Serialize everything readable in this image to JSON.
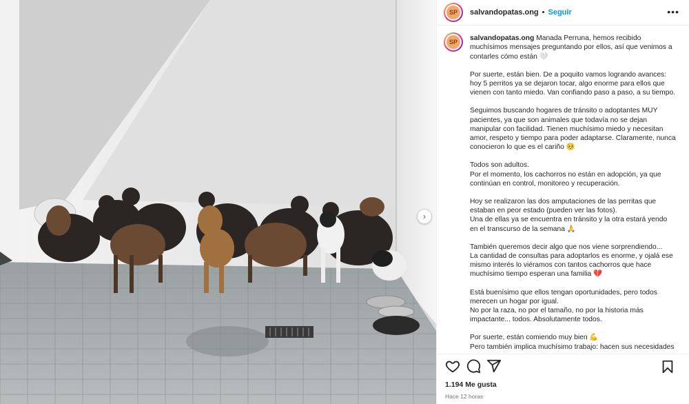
{
  "account": {
    "username": "salvandopatas.ong",
    "separator": "•",
    "follow_label": "Seguir",
    "more_icon": "more-horizontal-icon",
    "avatar_text": "SP"
  },
  "caption": {
    "username": "salvandopatas.ong",
    "paragraphs": [
      "Manada Perruna, hemos recibido muchísimos mensajes preguntando por ellos, así que venimos a contarles cómo están 🤍",
      "Por suerte, están bien. De a poquito vamos logrando avances: hoy 5 perritos ya se dejaron tocar, algo enorme para ellos que vienen con tanto miedo. Van confiando paso a paso, a su tiempo.",
      "Seguimos buscando hogares de tránsito o adoptantes MUY pacientes, ya que son animales que todavía no se dejan manipular con facilidad. Tienen muchísimo miedo y necesitan amor, respeto y tiempo para poder adaptarse. Claramente, nunca conocieron lo que es el cariño 🥺",
      "Todos son adultos.\nPor el momento, los cachorros no están en adopción, ya que continúan en control, monitoreo y recuperación.",
      "Hoy se realizaron las dos amputaciones de las perritas que estaban en peor estado (pueden ver las fotos).\nUna de ellas ya se encuentra en tránsito y la otra estará yendo en el transcurso de la semana 🙏",
      "También queremos decir algo que nos viene sorprendiendo...\nLa cantidad de consultas para adoptarlos es enorme, y ojalá ese mismo interés lo viéramos con tantos cachorros que hace muchísimo tiempo esperan una familia 💔",
      "Está buenísimo que ellos tengan oportunidades, pero todos merecen un hogar por igual.\nNo por la raza, no por el tamaño, no por la historia más impactante... todos. Absolutamente todos.",
      "Por suerte, están comiendo muy bien 💪\nPero también implica muchísimo trabajo: hacen sus necesidades"
    ]
  },
  "actions": {
    "like_icon": "heart-icon",
    "comment_icon": "comment-icon",
    "share_icon": "share-icon",
    "save_icon": "bookmark-icon"
  },
  "stats": {
    "likes": "1.194 Me gusta",
    "time_ago": "Hace 12 horas"
  },
  "media": {
    "next_icon": "chevron-right-icon",
    "next_glyph": "›"
  }
}
